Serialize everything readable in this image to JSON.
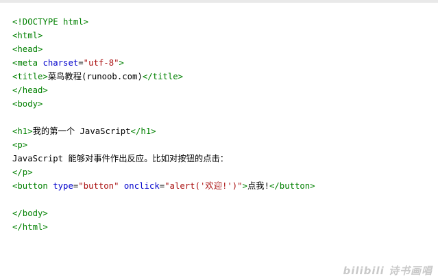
{
  "code": {
    "lines": [
      [
        {
          "t": "doctype",
          "v": "<!DOCTYPE html>"
        }
      ],
      [
        {
          "t": "tag",
          "v": "<html>"
        }
      ],
      [
        {
          "t": "tag",
          "v": "<head>"
        }
      ],
      [
        {
          "t": "tag",
          "v": "<meta"
        },
        {
          "t": "text",
          "v": " "
        },
        {
          "t": "attr",
          "v": "charset"
        },
        {
          "t": "text",
          "v": "="
        },
        {
          "t": "str",
          "v": "\"utf-8\""
        },
        {
          "t": "tag",
          "v": ">"
        }
      ],
      [
        {
          "t": "tag",
          "v": "<title>"
        },
        {
          "t": "text",
          "v": "菜鸟教程(runoob.com)"
        },
        {
          "t": "tag",
          "v": "</title>"
        }
      ],
      [
        {
          "t": "tag",
          "v": "</head>"
        }
      ],
      [
        {
          "t": "tag",
          "v": "<body>"
        }
      ],
      [],
      [
        {
          "t": "tag",
          "v": "<h1>"
        },
        {
          "t": "text",
          "v": "我的第一个 JavaScript"
        },
        {
          "t": "tag",
          "v": "</h1>"
        }
      ],
      [
        {
          "t": "tag",
          "v": "<p>"
        }
      ],
      [
        {
          "t": "text",
          "v": "JavaScript 能够对事件作出反应。比如对按钮的点击："
        }
      ],
      [
        {
          "t": "tag",
          "v": "</p>"
        }
      ],
      [
        {
          "t": "tag",
          "v": "<button"
        },
        {
          "t": "text",
          "v": " "
        },
        {
          "t": "attr",
          "v": "type"
        },
        {
          "t": "text",
          "v": "="
        },
        {
          "t": "str",
          "v": "\"button\""
        },
        {
          "t": "text",
          "v": " "
        },
        {
          "t": "attr",
          "v": "onclick"
        },
        {
          "t": "text",
          "v": "="
        },
        {
          "t": "str",
          "v": "\"alert('欢迎!')\""
        },
        {
          "t": "tag",
          "v": ">"
        },
        {
          "t": "text",
          "v": "点我!"
        },
        {
          "t": "tag",
          "v": "</button>"
        }
      ],
      [],
      [
        {
          "t": "tag",
          "v": "</body>"
        }
      ],
      [
        {
          "t": "tag",
          "v": "</html>"
        }
      ]
    ]
  },
  "watermark": "bilibili 诗书画唱",
  "colors": {
    "tag": "#008000",
    "attribute": "#0000cc",
    "string": "#aa1111",
    "text": "#000000"
  }
}
